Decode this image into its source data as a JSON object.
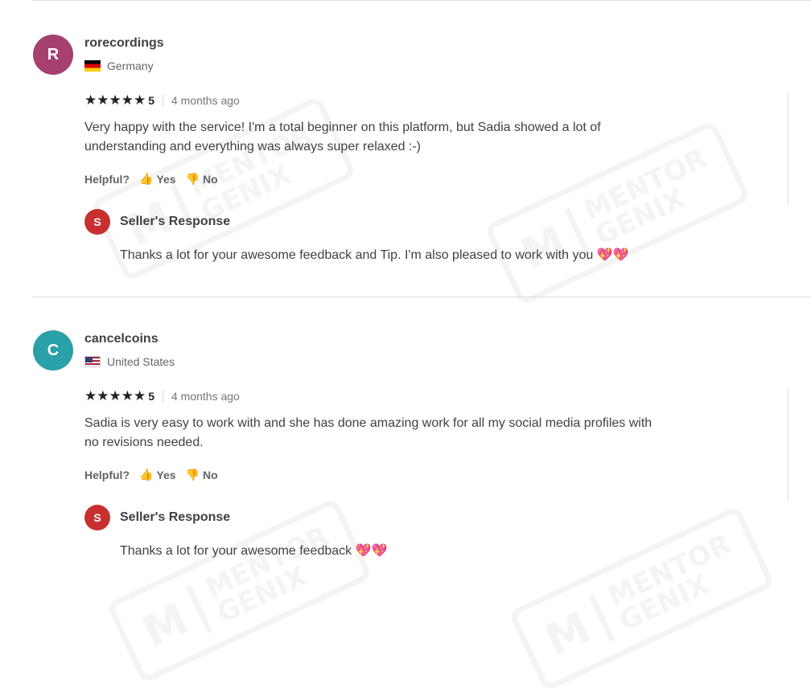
{
  "reviews": [
    {
      "avatar_letter": "R",
      "avatar_color": "#a6406f",
      "username": "rorecordings",
      "country": "Germany",
      "stars": "★★★★★",
      "rating": "5",
      "time": "4 months ago",
      "text": "Very happy with the service! I'm a total beginner on this platform, but Sadia showed a lot of understanding and everything was always super relaxed :-)",
      "helpful_label": "Helpful?",
      "yes_label": "Yes",
      "no_label": "No",
      "seller_avatar_letter": "S",
      "seller_title": "Seller's Response",
      "seller_text": "Thanks a lot for your awesome feedback and Tip. I'm also pleased to work with you",
      "seller_emoji": "💖💖"
    },
    {
      "avatar_letter": "C",
      "avatar_color": "#2aa0a8",
      "username": "cancelcoins",
      "country": "United States",
      "stars": "★★★★★",
      "rating": "5",
      "time": "4 months ago",
      "text": "Sadia is very easy to work with and she has done amazing work for all my social media profiles with no revisions needed.",
      "helpful_label": "Helpful?",
      "yes_label": "Yes",
      "no_label": "No",
      "seller_avatar_letter": "S",
      "seller_title": "Seller's Response",
      "seller_text": "Thanks a lot for your awesome feedback",
      "seller_emoji": "💖💖"
    }
  ],
  "icons": {
    "thumb_up": "👍",
    "thumb_down": "👍"
  },
  "watermark": {
    "logo": "M",
    "line1": "MENTOR",
    "line2": "GENIX"
  }
}
